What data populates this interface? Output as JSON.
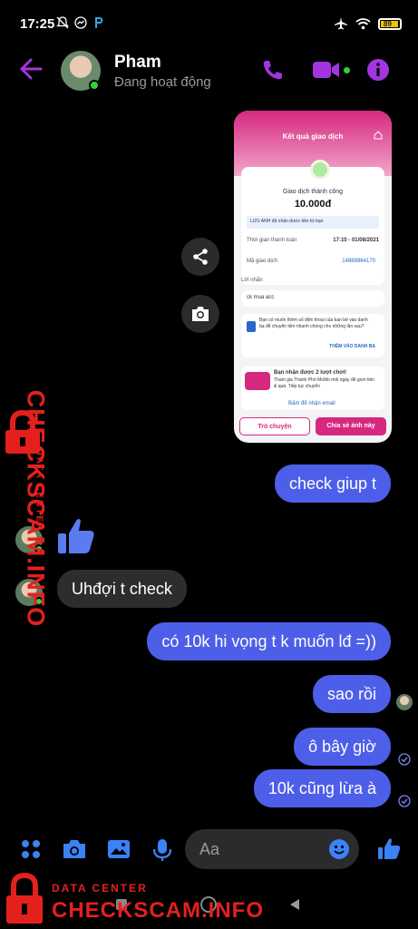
{
  "status_bar": {
    "time": "17:25",
    "battery": "89"
  },
  "header": {
    "name": "Pham",
    "status": "Đang hoạt động"
  },
  "colors": {
    "accent": "#a434e0",
    "bubble_out": "#4d5fe8",
    "bubble_in": "#2d2d2f",
    "online": "#31d13b",
    "watermark": "#e4201d"
  },
  "shared_image": {
    "title": "Kết quả giao dịch",
    "success_label": "Giao dịch thành công",
    "amount": "10.000đ",
    "notice": "LƯU ANH đã nhận được tiền từ bạn",
    "time_label": "Thời gian thanh toán",
    "time_value": "17:10 - 01/08/2021",
    "txn_label": "Mã giao dịch",
    "txn_value": "14888964170",
    "message_label": "Lời nhắn",
    "message_value": "ck mua acc",
    "save_prompt": "Bạn có muốn thêm số điện thoại của bạn bè vào danh bạ để chuyển tiền nhanh chóng cho những lần sau?",
    "save_link": "THÊM VÀO DANH BẠ",
    "promo_title": "Bạn nhận được 2 lượt chơi!",
    "promo_text": "Tham gia Thành Phố MoMo mỗi ngày để gom tiền & quà. Tiếp tục chuyển",
    "email_link": "Bấm để nhận email",
    "chat_button": "Trò chuyện",
    "share_button": "Chia sẻ ảnh này"
  },
  "messages": [
    {
      "text": "check giup t",
      "dir": "out"
    },
    {
      "text": "Uhđợi t check",
      "dir": "in"
    },
    {
      "text": "có 10k hi vọng t k muốn lđ =))",
      "dir": "out"
    },
    {
      "text": "sao rồi",
      "dir": "out"
    },
    {
      "text": "ô bây giờ",
      "dir": "out"
    },
    {
      "text": "10k cũng lừa à",
      "dir": "out"
    }
  ],
  "composer": {
    "placeholder": "Aa"
  },
  "watermark": {
    "small": "DATA CENTER",
    "big": "CHECKSCAM.INFO"
  },
  "icons": [
    "menu-icon",
    "camera-icon",
    "gallery-icon",
    "mic-icon",
    "emoji-icon",
    "like-icon",
    "share-icon",
    "phone-icon",
    "video-icon",
    "info-icon",
    "back-icon"
  ]
}
